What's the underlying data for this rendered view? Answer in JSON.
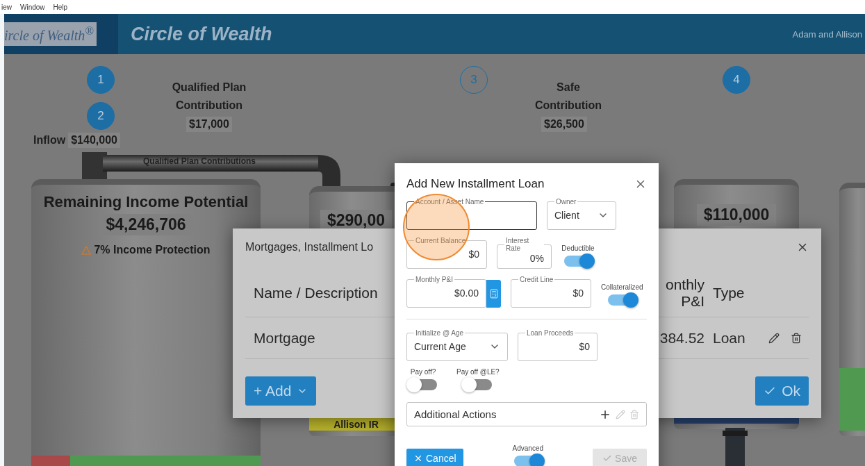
{
  "menu_bar": {
    "items": [
      "iew",
      "Window",
      "Help"
    ]
  },
  "header": {
    "logo": "ircle of Wealth$^{®}$",
    "title": "Circle of Wealth",
    "client": "Adam and Allison"
  },
  "diagram": {
    "steps": [
      {
        "label": "1",
        "selected": true
      },
      {
        "label": "2",
        "selected": true
      },
      {
        "label": "3",
        "selected": false
      },
      {
        "label": "4",
        "selected": true
      }
    ],
    "inflow": {
      "label": "Inflow",
      "amount": "$140,000"
    },
    "qualified_plan": {
      "title": "Qualified Plan Contribution",
      "amount": "$17,000",
      "pipe_label": "Qualified Plan Contributions"
    },
    "safe": {
      "title": "Safe Contribution",
      "amount": "$26,500"
    },
    "tanks": [
      {
        "title": "Remaining Income Potential",
        "amount": "$4,246,706",
        "note": "7% Income Protection"
      },
      {
        "amount": "$290,00",
        "band": "Allison IR"
      },
      {
        "amount": "$110,000"
      }
    ]
  },
  "loans_dialog": {
    "title": "Mortgages, Installment Lo",
    "columns": [
      "Name / Description",
      "onthly P&I",
      "Type"
    ],
    "rows": [
      {
        "name": "Mortgage",
        "monthly": "384.52",
        "type": "Loan"
      }
    ],
    "add_button": "+ Add",
    "ok_button": "Ok"
  },
  "add_loan_dialog": {
    "title": "Add New Installment Loan",
    "fields": [
      {
        "kind": "text",
        "label": "Account / Asset Name"
      },
      {
        "kind": "select",
        "label": "Owner",
        "value": "Client"
      },
      {
        "kind": "text",
        "label": "Current Balance",
        "value": "$0"
      },
      {
        "kind": "text",
        "label": "Interest Rate",
        "value": "0%"
      },
      {
        "kind": "toggle",
        "label": "Deductible",
        "on": true
      },
      {
        "kind": "calc",
        "label": "Monthly P&I",
        "value": "$0.00"
      },
      {
        "kind": "text",
        "label": "Credit Line",
        "value": "$0"
      },
      {
        "kind": "toggle",
        "label": "Collateralized",
        "on": true
      },
      {
        "kind": "select",
        "label": "Initialize @ Age",
        "value": "Current Age"
      },
      {
        "kind": "text",
        "label": "Loan Proceeds",
        "value": "$0"
      },
      {
        "kind": "toggle",
        "label": "Pay off?",
        "on": false
      },
      {
        "kind": "toggle",
        "label": "Pay off @LE?",
        "on": false
      }
    ],
    "additional_actions": "Additional Actions",
    "cancel_button": "Cancel",
    "advanced": {
      "label": "Advanced",
      "on": true
    },
    "save_button": {
      "label": "Save",
      "disabled": true
    }
  }
}
